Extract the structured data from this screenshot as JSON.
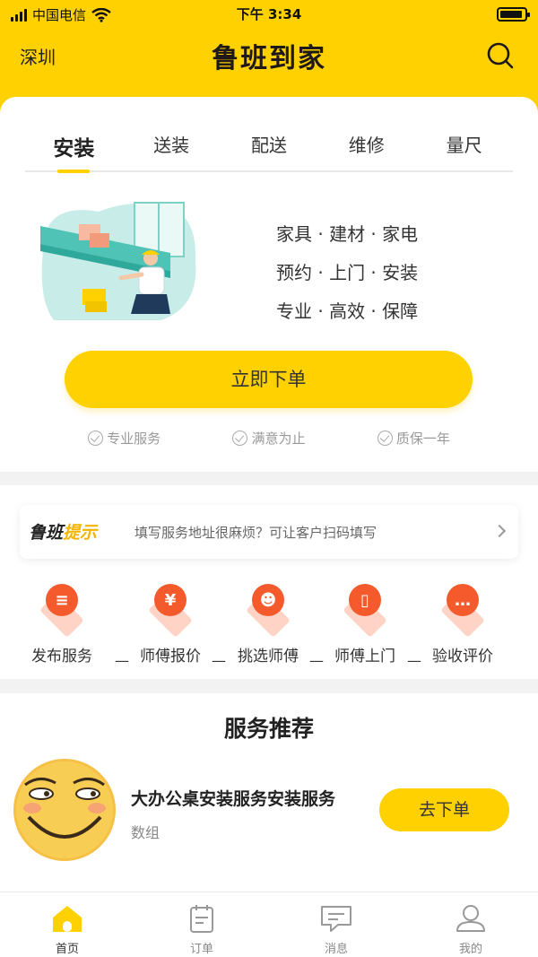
{
  "status_bar": {
    "carrier": "中国电信",
    "time": "下午 3:34"
  },
  "nav": {
    "city": "深圳",
    "title": "鲁班到家"
  },
  "tabs": [
    {
      "label": "安装",
      "active": true
    },
    {
      "label": "送装",
      "active": false
    },
    {
      "label": "配送",
      "active": false
    },
    {
      "label": "维修",
      "active": false
    },
    {
      "label": "量尺",
      "active": false
    }
  ],
  "slogans": [
    "家具 · 建材 · 家电",
    "预约 · 上门 · 安装",
    "专业 · 高效 · 保障"
  ],
  "order_button": "立即下单",
  "guarantees": [
    "专业服务",
    "满意为止",
    "质保一年"
  ],
  "tip": {
    "logo_main": "鲁班",
    "logo_highlight": "提示",
    "text": "填写服务地址很麻烦？可让客户扫码填写"
  },
  "steps": [
    {
      "label": "发布服务",
      "icon": "document-icon",
      "glyph": "≡"
    },
    {
      "label": "师傅报价",
      "icon": "yuan-icon",
      "glyph": "¥"
    },
    {
      "label": "挑选师傅",
      "icon": "worker-icon",
      "glyph": "☻"
    },
    {
      "label": "师傅上门",
      "icon": "door-icon",
      "glyph": "▯"
    },
    {
      "label": "验收评价",
      "icon": "chat-icon",
      "glyph": "…"
    }
  ],
  "step_separator": "—",
  "recommend": {
    "title": "服务推荐",
    "item_name": "大办公桌安装服务安装服务",
    "item_sub": "数组",
    "button": "去下单"
  },
  "tabbar": [
    {
      "label": "首页",
      "icon": "home-icon",
      "active": true
    },
    {
      "label": "订单",
      "icon": "calendar-icon",
      "active": false
    },
    {
      "label": "消息",
      "icon": "message-icon",
      "active": false
    },
    {
      "label": "我的",
      "icon": "profile-icon",
      "active": false
    }
  ],
  "colors": {
    "brand_yellow": "#ffd100",
    "step_orange": "#f55a2c"
  }
}
